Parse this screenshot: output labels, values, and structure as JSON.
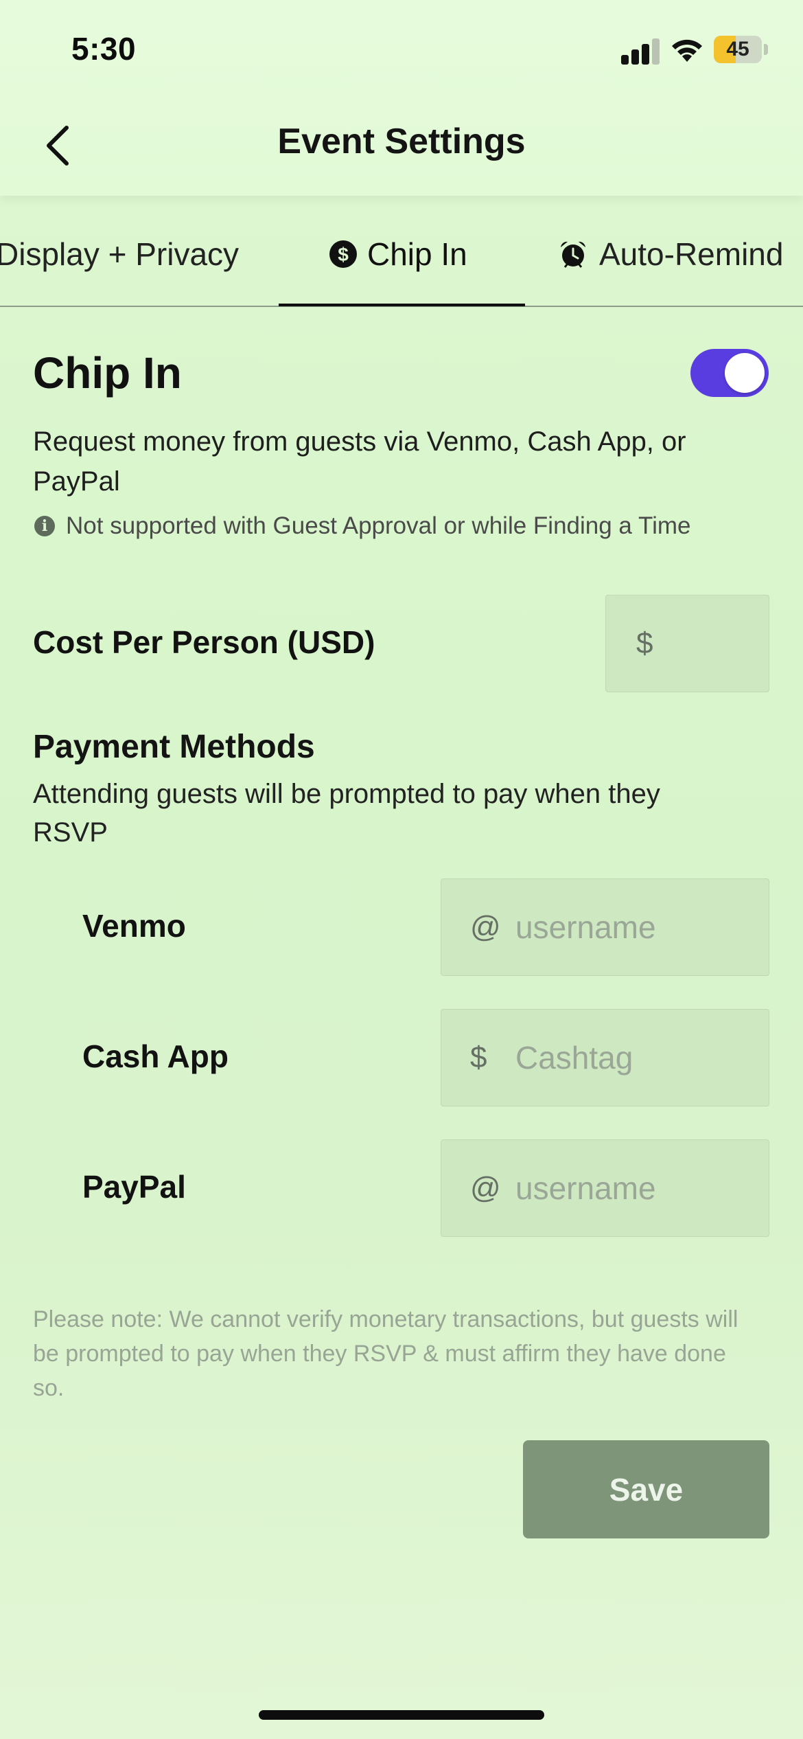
{
  "status_bar": {
    "time": "5:30",
    "battery_level": "45",
    "battery_fraction": 0.45
  },
  "nav": {
    "title": "Event Settings",
    "back_icon": "chevron-left-icon"
  },
  "tabs": [
    {
      "label": "Display + Privacy",
      "icon": "",
      "active": false
    },
    {
      "label": "Chip In",
      "icon": "dollar-circle-icon",
      "active": true
    },
    {
      "label": "Auto-Remind",
      "icon": "alarm-clock-icon",
      "active": false
    }
  ],
  "chip_in": {
    "title": "Chip In",
    "toggle_on": true,
    "description": "Request money from guests via Venmo, Cash App, or PayPal",
    "info_note": "Not supported with Guest Approval or while Finding a Time"
  },
  "cost": {
    "label": "Cost Per Person (USD)",
    "prefix": "$",
    "value": ""
  },
  "payment_methods": {
    "title": "Payment Methods",
    "description": "Attending guests will be prompted to pay when they RSVP",
    "methods": [
      {
        "label": "Venmo",
        "prefix": "@",
        "placeholder": "username",
        "value": ""
      },
      {
        "label": "Cash App",
        "prefix": "$",
        "placeholder": "Cashtag",
        "value": ""
      },
      {
        "label": "PayPal",
        "prefix": "@",
        "placeholder": "username",
        "value": ""
      }
    ]
  },
  "footer_note": "Please note: We cannot verify monetary transactions, but guests will be prompted to pay when they RSVP & must affirm they have done so.",
  "save_label": "Save",
  "colors": {
    "toggle_on": "#5a3de0",
    "save_button": "#7e957a",
    "battery": "#f4c22c"
  }
}
